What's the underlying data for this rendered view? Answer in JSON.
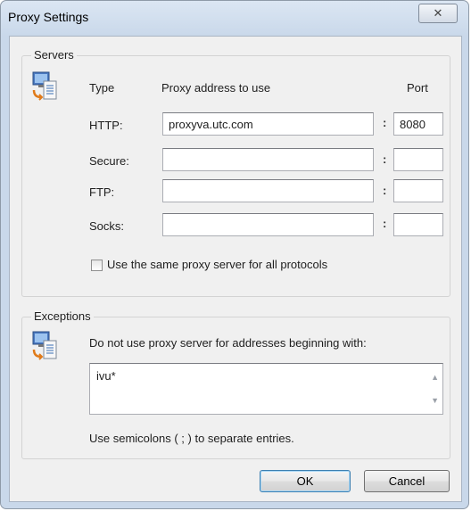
{
  "window": {
    "title": "Proxy Settings",
    "close_glyph": "✕"
  },
  "servers": {
    "group_label": "Servers",
    "icon": "network-computer-icon",
    "col_type": "Type",
    "col_address": "Proxy address to use",
    "col_port": "Port",
    "colon": ":",
    "rows": [
      {
        "type": "HTTP:",
        "address": "proxyva.utc.com",
        "port": "8080"
      },
      {
        "type": "Secure:",
        "address": "",
        "port": ""
      },
      {
        "type": "FTP:",
        "address": "",
        "port": ""
      },
      {
        "type": "Socks:",
        "address": "",
        "port": ""
      }
    ],
    "same_proxy_label": "Use the same proxy server for all protocols",
    "same_proxy_checked": false
  },
  "exceptions": {
    "group_label": "Exceptions",
    "icon": "network-computer-icon",
    "description": "Do not use proxy server for addresses beginning with:",
    "value": "ivu*",
    "hint": "Use semicolons ( ; ) to separate entries."
  },
  "buttons": {
    "ok": "OK",
    "cancel": "Cancel"
  }
}
